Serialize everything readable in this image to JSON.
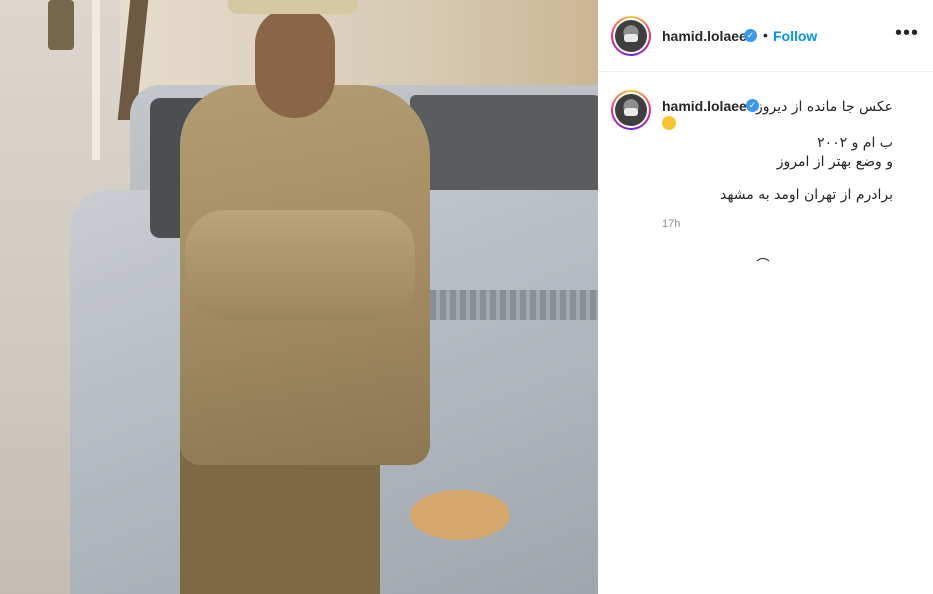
{
  "post": {
    "username": "hamid.lolaee",
    "verified_symbol": "✓",
    "follow_label": "Follow",
    "separator": "•",
    "more_label": "•••"
  },
  "caption": {
    "username": "hamid.lolaee",
    "lines": [
      "عکس جا مانده از دیروز",
      "ب ام و ۲۰۰۲",
      "و وضع بهتر از امروز",
      "برادرم از تهران اومد به مشهد"
    ],
    "emoji": "rolling-on-floor-laughing-emoji",
    "timestamp": "17h"
  },
  "icons": {
    "avatar": "profile-avatar",
    "verified": "verified-badge-icon",
    "more": "more-options-icon",
    "loading": "loading-spinner-icon"
  },
  "colors": {
    "follow": "#0095f6",
    "verified": "#3897f0",
    "text": "#262626",
    "meta": "#8e8e8e"
  }
}
